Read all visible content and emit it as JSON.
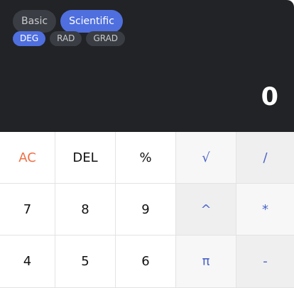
{
  "modes": [
    {
      "label": "Basic",
      "active": false
    },
    {
      "label": "Scientific",
      "active": true
    }
  ],
  "angle_units": [
    {
      "label": "DEG",
      "active": true
    },
    {
      "label": "RAD",
      "active": false
    },
    {
      "label": "GRAD",
      "active": false
    }
  ],
  "display": {
    "value": "0"
  },
  "keys": [
    [
      "AC",
      "DEL",
      "%",
      "√",
      "/"
    ],
    [
      "7",
      "8",
      "9",
      "^",
      "*"
    ],
    [
      "4",
      "5",
      "6",
      "π",
      "-"
    ]
  ],
  "colors": {
    "display_bg": "#212326",
    "accent": "#4f6fdf",
    "clear_text": "#ee7046",
    "operator_text": "#4a63c9"
  }
}
